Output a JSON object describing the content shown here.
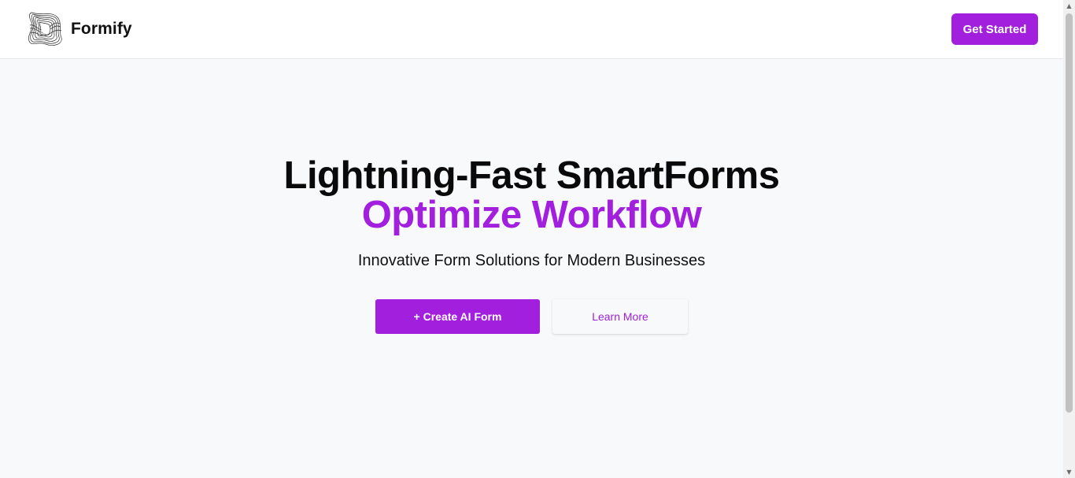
{
  "header": {
    "brand_name": "Formify",
    "logo_icon": "wireframe-knot-logo-icon",
    "get_started_label": "Get Started"
  },
  "hero": {
    "headline": "Lightning-Fast SmartForms",
    "headline_accent": "Optimize Workflow",
    "subtitle": "Innovative Form Solutions for Modern Businesses",
    "primary_cta_label": "+ Create AI Form",
    "secondary_cta_label": "Learn More"
  },
  "colors": {
    "accent": "#a21fdd",
    "page_background": "#f8f9fb",
    "header_background": "#ffffff",
    "text": "#0a0a0a"
  },
  "scrollbar": {
    "up_icon": "scroll-up-arrow-icon",
    "down_icon": "scroll-down-arrow-icon"
  }
}
